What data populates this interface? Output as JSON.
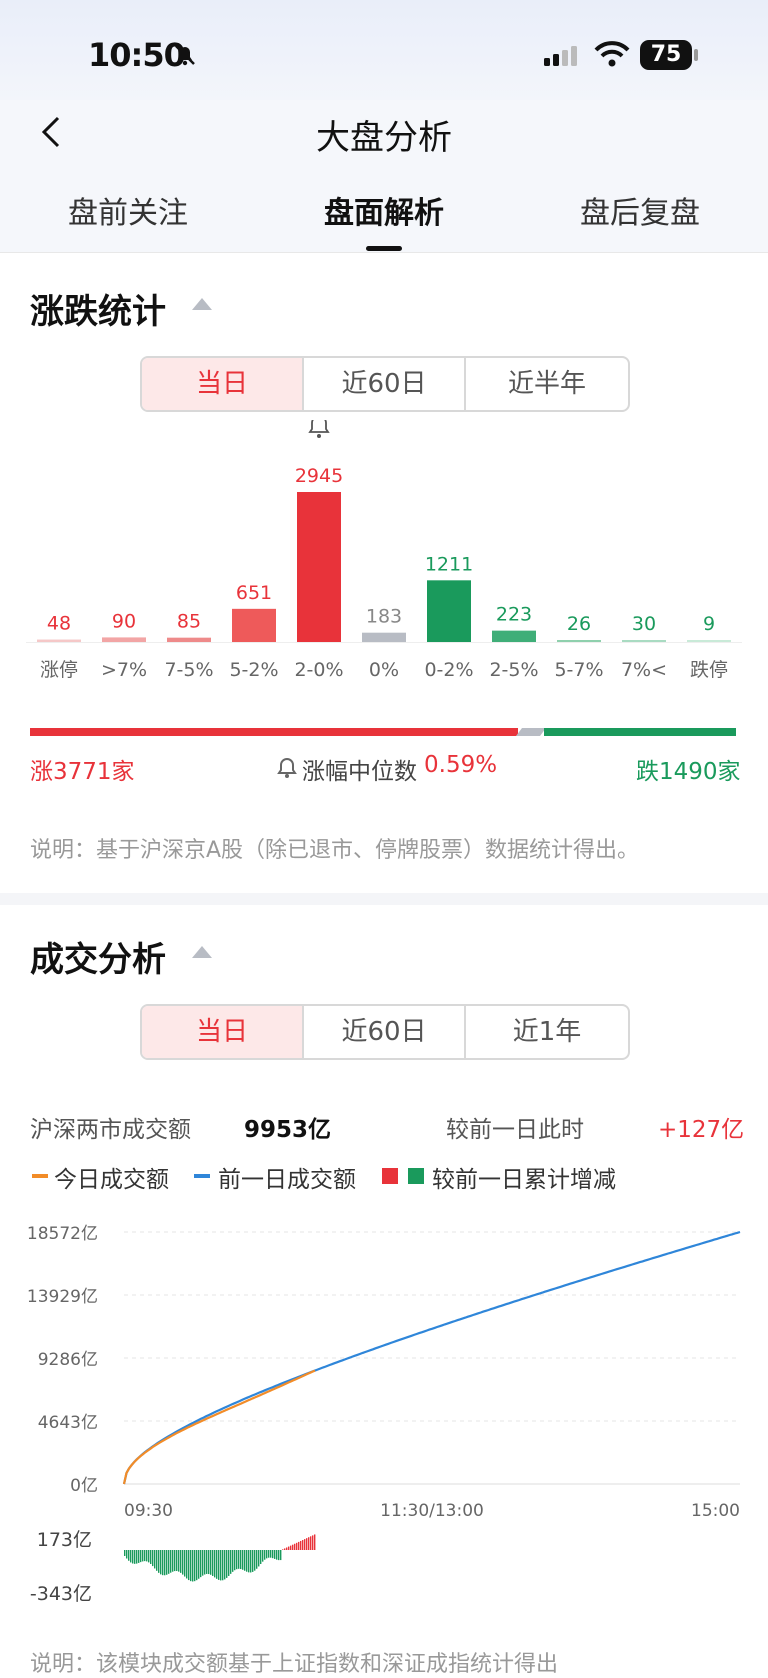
{
  "status_bar": {
    "time": "10:50",
    "battery": "75"
  },
  "header": {
    "title": "大盘分析"
  },
  "tabs": [
    "盘前关注",
    "盘面解析",
    "盘后复盘"
  ],
  "section1": {
    "title": "涨跌统计",
    "segments": [
      "当日",
      "近60日",
      "近半年"
    ],
    "chart_data": {
      "type": "bar",
      "categories": [
        "涨停",
        ">7%",
        "7-5%",
        "5-2%",
        "2-0%",
        "0%",
        "0-2%",
        "2-5%",
        "5-7%",
        "7%<",
        "跌停"
      ],
      "values": [
        48,
        90,
        85,
        651,
        2945,
        183,
        1211,
        223,
        26,
        30,
        9
      ],
      "labels": [
        "48",
        "90",
        "85",
        "651",
        "2945",
        "183",
        "1211",
        "223",
        "26",
        "30",
        "9"
      ],
      "colors": [
        "#f5c8c8",
        "#f2a5a5",
        "#ee8a8a",
        "#ee5a5a",
        "#e8333a",
        "#b8bcc4",
        "#1a9a5c",
        "#3fae78",
        "#8fd0ad",
        "#a9dbc2",
        "#c9ead8"
      ],
      "label_colors": [
        "#e8333a",
        "#e8333a",
        "#e8333a",
        "#e8333a",
        "#e8333a",
        "#888888",
        "#1a9a5c",
        "#1a9a5c",
        "#1a9a5c",
        "#1a9a5c",
        "#1a9a5c"
      ]
    },
    "up_count": "涨3771家",
    "median_label": "涨幅中位数",
    "median_value": "0.59%",
    "down_count": "跌1490家",
    "note": "说明：基于沪深京A股（除已退市、停牌股票）数据统计得出。"
  },
  "section2": {
    "title": "成交分析",
    "segments": [
      "当日",
      "近60日",
      "近1年"
    ],
    "turnover_label": "沪深两市成交额",
    "turnover_value": "9953亿",
    "compare_label": "较前一日此时",
    "compare_value": "+127亿",
    "legend": [
      "今日成交额",
      "前一日成交额",
      "较前一日累计增减"
    ],
    "note": "说明：该模块成交额基于上证指数和深证成指统计得出"
  },
  "chart_data_2": {
    "type": "line",
    "y_ticks": [
      "18572亿",
      "13929亿",
      "9286亿",
      "4643亿",
      "0亿"
    ],
    "y_values": [
      18572,
      13929,
      9286,
      4643,
      0
    ],
    "x_ticks": [
      "09:30",
      "11:30/13:00",
      "15:00"
    ],
    "diff_ticks": [
      "173亿",
      "-343亿"
    ],
    "colors": {
      "today": "#f28c28",
      "prev": "#2f86d9",
      "up": "#e8333a",
      "down": "#1a9a5c"
    }
  }
}
